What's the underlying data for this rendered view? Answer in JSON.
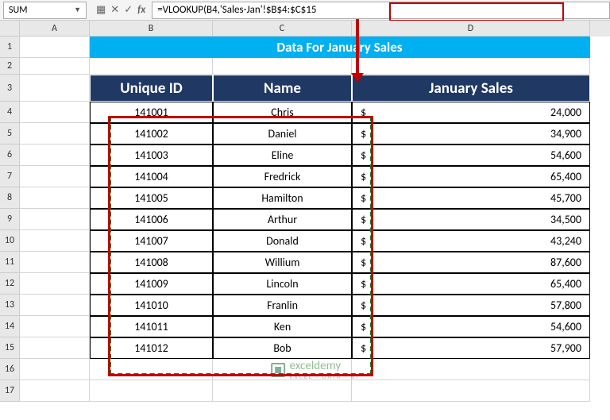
{
  "namebox": {
    "value": "SUM"
  },
  "formula": {
    "prefix": "=VLOOKUP(B4,",
    "highlight": "'Sales-Jan'!$B$4:$C$15"
  },
  "columns": [
    "A",
    "B",
    "C",
    "D"
  ],
  "row_numbers": [
    1,
    2,
    3,
    4,
    5,
    6,
    7,
    8,
    9,
    10,
    11,
    12,
    13,
    14,
    15,
    16,
    17
  ],
  "banner": "Data For January Sales",
  "headers": {
    "b": "Unique ID",
    "c": "Name",
    "d": "January Sales"
  },
  "currency": "$",
  "rows_data": [
    {
      "id": "141001",
      "name": "Chris",
      "sales": "24,000"
    },
    {
      "id": "141002",
      "name": "Daniel",
      "sales": "34,900"
    },
    {
      "id": "141003",
      "name": "Eline",
      "sales": "54,600"
    },
    {
      "id": "141004",
      "name": "Fredrick",
      "sales": "65,400"
    },
    {
      "id": "141005",
      "name": "Hamilton",
      "sales": "45,700"
    },
    {
      "id": "141006",
      "name": "Arthur",
      "sales": "34,500"
    },
    {
      "id": "141007",
      "name": "Donald",
      "sales": "43,240"
    },
    {
      "id": "141008",
      "name": "Willium",
      "sales": "87,600"
    },
    {
      "id": "141009",
      "name": "Lincoln",
      "sales": "65,400"
    },
    {
      "id": "141010",
      "name": "Franlin",
      "sales": "57,800"
    },
    {
      "id": "141011",
      "name": "Ken",
      "sales": "54,600"
    },
    {
      "id": "141012",
      "name": "Bob",
      "sales": "57,900"
    }
  ],
  "watermark": {
    "name": "exceldemy",
    "sub": "EXCEL · DATA · BI"
  }
}
